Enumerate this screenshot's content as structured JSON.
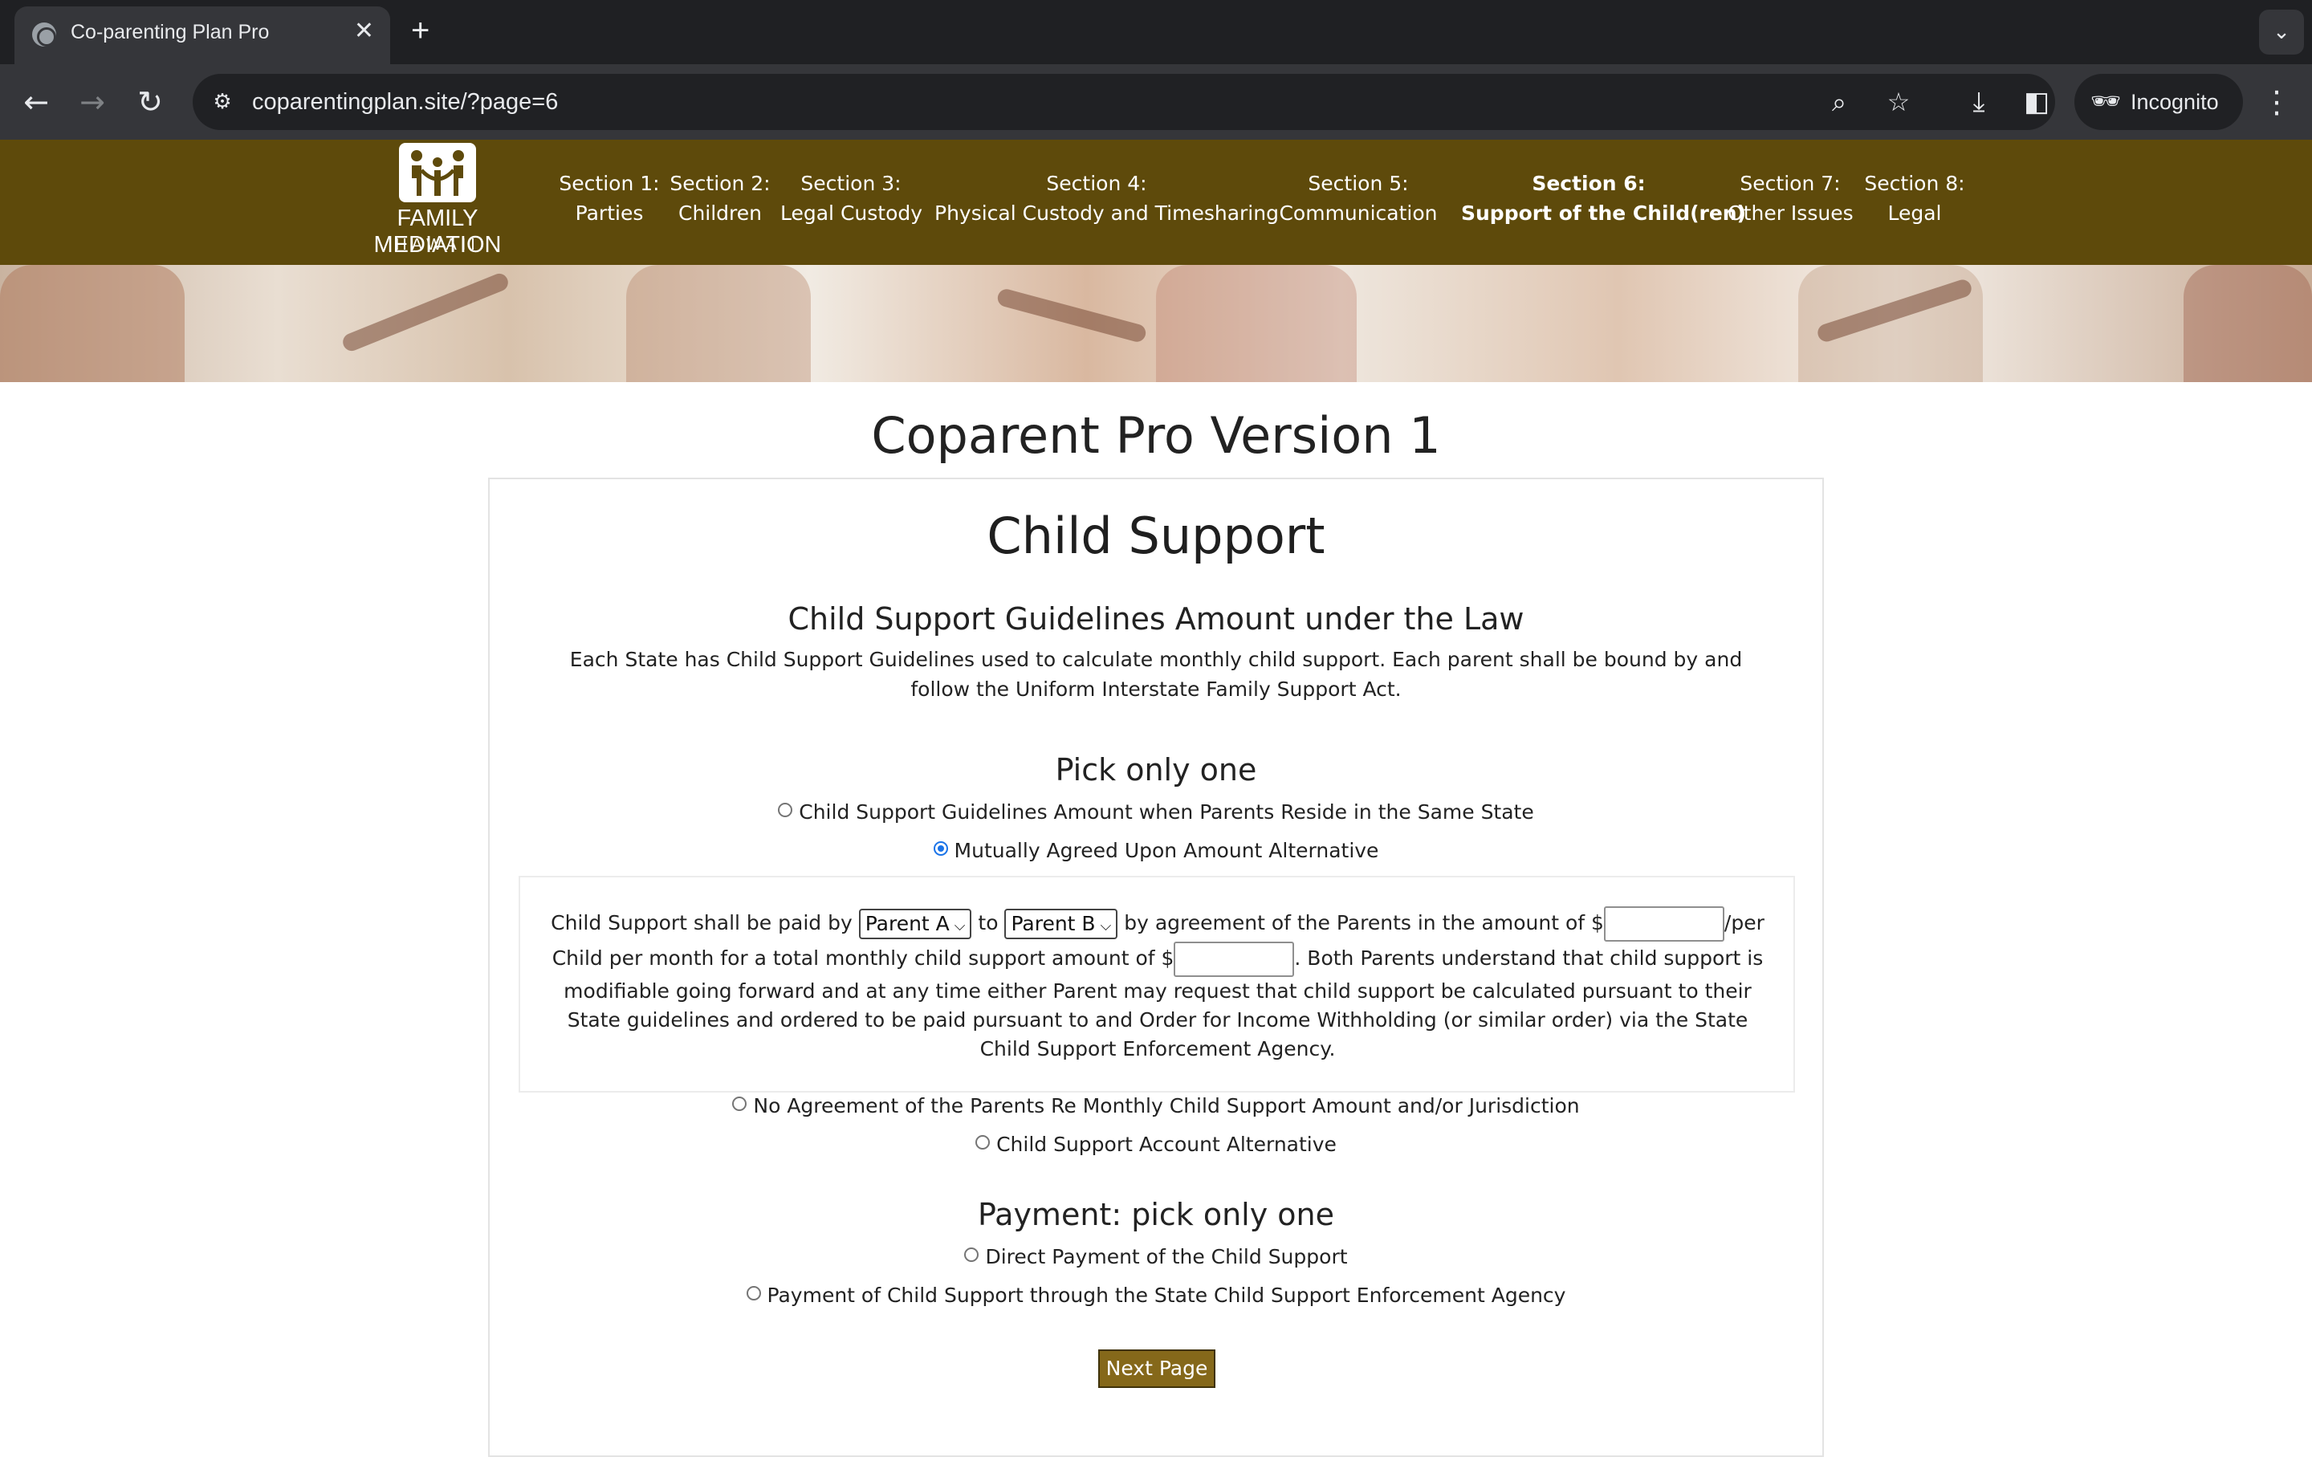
{
  "browser": {
    "tab_title": "Co-parenting Plan Pro",
    "url": "coparentingplan.site/?page=6",
    "incognito_label": "Incognito"
  },
  "site": {
    "logo_name": "FAMILY MEDIATION",
    "logo_sub": "HAWAII",
    "nav": [
      {
        "line1": "Section 1:",
        "line2": "Parties",
        "active": false
      },
      {
        "line1": "Section 2:",
        "line2": "Children",
        "active": false
      },
      {
        "line1": "Section 3:",
        "line2": "Legal Custody",
        "active": false
      },
      {
        "line1": "Section 4:",
        "line2": "Physical Custody and Timesharing",
        "active": false
      },
      {
        "line1": "Section 5:",
        "line2": "Communication",
        "active": false
      },
      {
        "line1": "Section 6:",
        "line2": "Support of the Child(ren)",
        "active": true
      },
      {
        "line1": "Section 7:",
        "line2": "Other Issues",
        "active": false
      },
      {
        "line1": "Section 8:",
        "line2": "Legal",
        "active": false
      }
    ],
    "brand_color": "#5e4a0b"
  },
  "page": {
    "title": "Coparent Pro Version 1",
    "card_title": "Child Support",
    "guidelines_heading": "Child Support Guidelines Amount under the Law",
    "guidelines_text": "Each State has Child Support Guidelines used to calculate monthly child support. Each parent shall be bound by and follow the Uniform Interstate Family Support Act.",
    "pick_heading": "Pick only one",
    "options": [
      {
        "label": "Child Support Guidelines Amount when Parents Reside in the Same State",
        "checked": false
      },
      {
        "label": "Mutually Agreed Upon Amount Alternative",
        "checked": true
      },
      {
        "label": "No Agreement of the Parents Re Monthly Child Support Amount and/or Jurisdiction",
        "checked": false
      },
      {
        "label": "Child Support Account Alternative",
        "checked": false
      }
    ],
    "agreement": {
      "text_1": "Child Support shall be paid by",
      "payer": "Parent A",
      "text_2": "to",
      "payee": "Parent B",
      "text_3": "by agreement of the Parents in the amount of $",
      "per_child_amount": "",
      "text_4": "/per Child per month for a total monthly child support amount of $",
      "total_amount": "",
      "text_5": ". Both Parents understand that child support is modifiable going forward and at any time either Parent may request that child support be calculated pursuant to their State guidelines and ordered to be paid pursuant to and Order for Income Withholding (or similar order) via the State Child Support Enforcement Agency."
    },
    "payment_heading": "Payment: pick only one",
    "payment_options": [
      {
        "label": "Direct Payment of the Child Support",
        "checked": false
      },
      {
        "label": "Payment of Child Support through the State Child Support Enforcement Agency",
        "checked": false
      }
    ],
    "next_button": "Next Page"
  }
}
